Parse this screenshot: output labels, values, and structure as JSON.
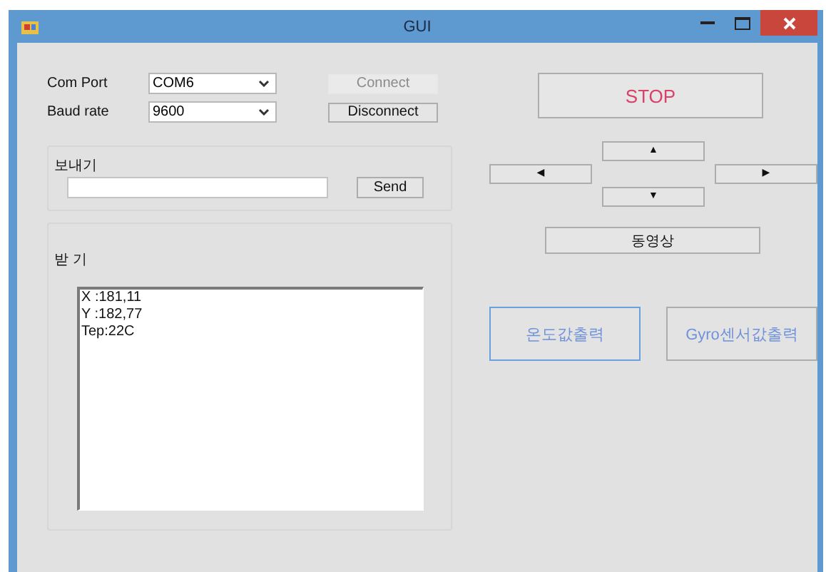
{
  "window": {
    "title": "GUI"
  },
  "connection": {
    "fields": [
      {
        "label": "Com Port",
        "value": "COM6"
      },
      {
        "label": "Baud rate",
        "value": "9600"
      }
    ],
    "buttons": [
      {
        "label": "Connect",
        "disabled": true
      },
      {
        "label": "Disconnect",
        "disabled": false
      }
    ]
  },
  "stop_button": {
    "label": "STOP"
  },
  "send": {
    "title": "보내기",
    "button": "Send"
  },
  "direction_buttons": [
    {
      "label": "▲",
      "kind": "up"
    },
    {
      "label": "◀",
      "kind": "left"
    },
    {
      "label": "▶",
      "kind": "right"
    },
    {
      "label": "▼",
      "kind": "down"
    }
  ],
  "video_button": {
    "label": "동영상"
  },
  "receive": {
    "title": "받 기",
    "lines": [
      "X :181,11",
      "Y :182,77",
      "Tep:22C"
    ]
  },
  "output_buttons": [
    {
      "label": "온도값출력",
      "focused": true
    },
    {
      "label": "Gyro센서값출력",
      "focused": false
    }
  ]
}
